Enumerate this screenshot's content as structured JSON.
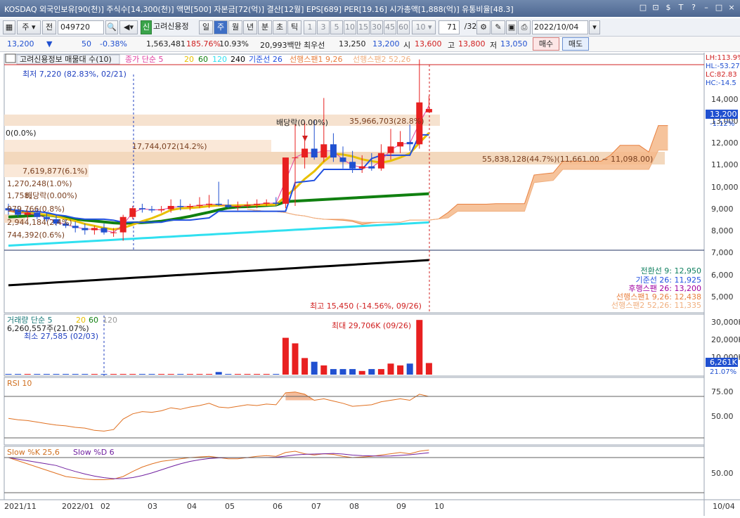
{
  "title": "KOSDAQ 외국인보유[90(천)] 주식수[14,300(천)] 액면[500] 자본금[72(억)] 결산[12월] EPS[689] PER[19.16] 시가총액[1,888(억)] 유통비율[48.3]",
  "window_buttons": [
    "□",
    "⊡",
    "$",
    "T",
    "?",
    "–",
    "□",
    "×"
  ],
  "toolbar": {
    "period_mode": "주",
    "prev_label": "전",
    "code": "049720",
    "credit_badge": "신",
    "stock_name": "고려신용정",
    "periods": [
      "일",
      "주",
      "월",
      "년",
      "분",
      "초",
      "틱"
    ],
    "selected_period": "주",
    "minutes": [
      "1",
      "3",
      "5",
      "10",
      "15",
      "30",
      "45",
      "60"
    ],
    "interval": "10",
    "count": "71",
    "total": "/325",
    "date": "2022/10/04"
  },
  "quote": {
    "price": "13,200",
    "change": "50",
    "change_pct": "-0.38%",
    "volume": "1,563,481",
    "vol_ratio": "185.76%",
    "turnover": "10.93%",
    "amount": "20,993백만",
    "best_label": "최우선",
    "best_sell": "13,250",
    "best_buy": "13,200",
    "open_label": "시",
    "open": "13,600",
    "high_label": "고",
    "high": "13,800",
    "low_label": "저",
    "low": "13,050",
    "buy_btn": "매수",
    "sell_btn": "매도"
  },
  "price_panel": {
    "header": "고려신용정보 매물대 수(10)",
    "ma_legend": [
      {
        "label": "종가 단순 5",
        "color": "#e040a0"
      },
      {
        "label": "20",
        "color": "#e8c000"
      },
      {
        "label": "60",
        "color": "#108010"
      },
      {
        "label": "120",
        "color": "#30e0f0"
      },
      {
        "label": "240",
        "color": "#000000"
      },
      {
        "label": "기준선 26",
        "color": "#2050e0"
      },
      {
        "label": "선행스팬1 9,26",
        "color": "#e88040"
      },
      {
        "label": "선행스팬2 52,26",
        "color": "#f0b080"
      }
    ],
    "min_label": "최저 7,220 (82.83%, 02/21)",
    "max_label": "최고 15,450 (-14.56%, 09/26)",
    "div_label": "배당락(0.00%)",
    "div_label2": "배당락(0.00%)",
    "vp_labels": [
      {
        "text": "35,966,703(28.8%)",
        "row": 0
      },
      {
        "text": "0(0.0%)",
        "row": 1
      },
      {
        "text": "17,744,072(14.2%)",
        "row": 2
      },
      {
        "text": "55,838,128(44.7%)(11,661.00 ~ 11,098.00)",
        "row": 3
      },
      {
        "text": "7,619,877(6.1%)",
        "row": 4
      },
      {
        "text": "1,270,248(1.0%)",
        "row": 5
      },
      {
        "text": "1,758,",
        "row": 6
      },
      {
        "text": "979,766(0.8%)",
        "row": 7
      },
      {
        "text": "2,944,184(2.4%)",
        "row": 8
      },
      {
        "text": "744,392(0.6%)",
        "row": 9
      }
    ],
    "y_ticks": [
      "14,000",
      "13,000",
      "12,000",
      "11,000",
      "10,000",
      "9,000",
      "8,000",
      "7,000",
      "6,000",
      "5,000"
    ],
    "side_tags": [
      "LH:113.9%",
      "HL:-53.27",
      "LC:82.83",
      "HC:-14.5"
    ],
    "price_tag": "13,200",
    "price_tag_pct": "-1.12%",
    "ichimoku_legend": [
      {
        "label": "전환선 9: 12,950",
        "color": "#108060"
      },
      {
        "label": "기준선 26: 11,925",
        "color": "#2050e0"
      },
      {
        "label": "후행스팬 26: 13,200",
        "color": "#a000a0"
      },
      {
        "label": "선행스팬1 9,26: 12,438",
        "color": "#e88040"
      },
      {
        "label": "선행스팬2 52,26: 11,335",
        "color": "#f0b080"
      }
    ]
  },
  "volume_panel": {
    "header": "거래량 단순 5",
    "ma": [
      "20",
      "60",
      "120"
    ],
    "last": "6,260,557주(21.07%)",
    "min_label": "최소 27,585 (02/03)",
    "max_label": "최대 29,706K (09/26)",
    "y_ticks": [
      "30,000K",
      "20,000K",
      "10,000K"
    ],
    "tag": "6,261K",
    "tag_pct": "21.07%"
  },
  "rsi_panel": {
    "header": "RSI 10",
    "y_ticks": [
      "75.00",
      "50.00"
    ]
  },
  "stoch_panel": {
    "header_k": "Slow %K 25,6",
    "header_d": "Slow %D 6",
    "y_ticks": [
      "50.00"
    ]
  },
  "x_axis": [
    "2021/11",
    "2022/01",
    "02",
    "03",
    "04",
    "05",
    "06",
    "07",
    "08",
    "09",
    "10"
  ],
  "x_axis_right": "10/04",
  "colors": {
    "up": "#e82020",
    "down": "#2050d0",
    "accent": "#3f6fc5"
  },
  "chart_data": {
    "type": "candlestick",
    "x": [
      "2021-11-22",
      "2021-11-29",
      "2021-12-06",
      "2021-12-13",
      "2021-12-20",
      "2021-12-27",
      "2022-01-03",
      "2022-01-10",
      "2022-01-17",
      "2022-01-24",
      "2022-02-07",
      "2022-02-14",
      "2022-02-21",
      "2022-02-28",
      "2022-03-07",
      "2022-03-14",
      "2022-03-21",
      "2022-03-28",
      "2022-04-04",
      "2022-04-11",
      "2022-04-18",
      "2022-04-25",
      "2022-05-02",
      "2022-05-09",
      "2022-05-16",
      "2022-05-23",
      "2022-05-30",
      "2022-06-06",
      "2022-06-13",
      "2022-06-20",
      "2022-06-27",
      "2022-07-04",
      "2022-07-11",
      "2022-07-18",
      "2022-07-25",
      "2022-08-01",
      "2022-08-08",
      "2022-08-15",
      "2022-08-22",
      "2022-08-29",
      "2022-09-05",
      "2022-09-12",
      "2022-09-19",
      "2022-09-26",
      "2022-10-03"
    ],
    "open": [
      8700,
      8600,
      8400,
      8500,
      8300,
      8200,
      8000,
      7900,
      7800,
      7700,
      7800,
      7600,
      7600,
      8300,
      8700,
      8650,
      8600,
      8650,
      8800,
      8750,
      8800,
      8850,
      8900,
      8850,
      8750,
      8800,
      8850,
      8900,
      8950,
      8900,
      11000,
      11000,
      11400,
      11000,
      11600,
      11000,
      10800,
      10500,
      10600,
      10500,
      11200,
      11500,
      11700,
      11600,
      13050
    ],
    "high": [
      8900,
      8800,
      8600,
      8700,
      8500,
      8400,
      8200,
      8100,
      8000,
      7900,
      8000,
      7800,
      8400,
      8800,
      8900,
      8800,
      8800,
      9100,
      9100,
      8900,
      9200,
      9300,
      9900,
      9100,
      9000,
      9000,
      9100,
      9100,
      9200,
      9100,
      12500,
      12600,
      12700,
      13700,
      12100,
      11500,
      11300,
      11100,
      11200,
      11600,
      12300,
      12200,
      12500,
      15450,
      13800
    ],
    "low": [
      8400,
      8300,
      8200,
      8200,
      8100,
      7900,
      7800,
      7600,
      7500,
      7500,
      7500,
      7400,
      7220,
      8200,
      8500,
      8500,
      8500,
      8500,
      8600,
      8600,
      8700,
      8700,
      8800,
      8700,
      8600,
      8700,
      8700,
      8800,
      8800,
      8700,
      8800,
      10500,
      10900,
      10800,
      10800,
      10500,
      10300,
      10300,
      10400,
      10400,
      10900,
      11200,
      11300,
      11400,
      13050
    ],
    "close": [
      8600,
      8400,
      8500,
      8300,
      8200,
      8000,
      7900,
      7800,
      7700,
      7800,
      7600,
      7600,
      8300,
      8700,
      8650,
      8600,
      8650,
      8800,
      8750,
      8800,
      8850,
      8900,
      8850,
      8750,
      8800,
      8850,
      8900,
      8950,
      8900,
      11000,
      11000,
      11400,
      11000,
      11600,
      11000,
      10800,
      10500,
      10600,
      10500,
      11200,
      11500,
      11700,
      11600,
      13500,
      13200
    ]
  }
}
